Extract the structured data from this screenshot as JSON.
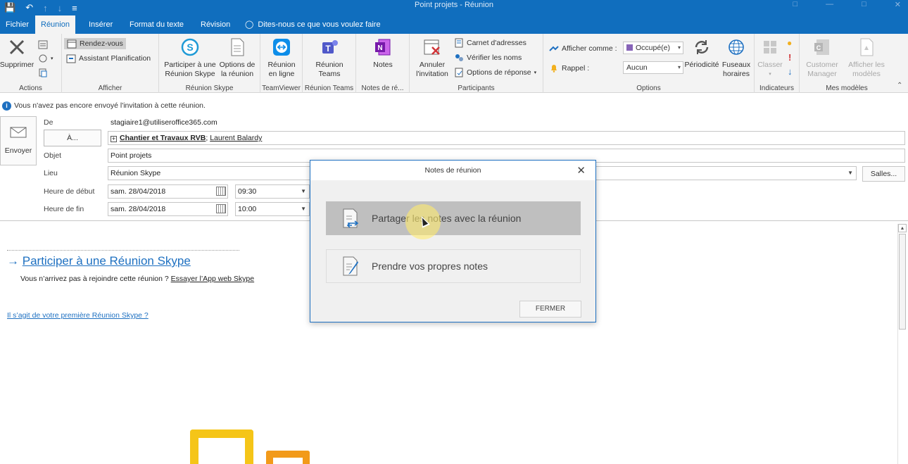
{
  "window": {
    "title": "Point projets  -  Réunion"
  },
  "ribbon_tabs": [
    {
      "label": "Fichier"
    },
    {
      "label": "Réunion"
    },
    {
      "label": "Insérer"
    },
    {
      "label": "Format du texte"
    },
    {
      "label": "Révision"
    }
  ],
  "tell_me": "Dites-nous ce que vous voulez faire",
  "ribbon": {
    "actions": {
      "label": "Actions",
      "supprimer": "Supprimer"
    },
    "afficher": {
      "label": "Afficher",
      "rendez_vous": "Rendez-vous",
      "assistant": "Assistant Planification"
    },
    "skype": {
      "label": "Réunion Skype",
      "participer_1": "Participer à une",
      "participer_2": "Réunion Skype",
      "options_1": "Options de",
      "options_2": "la réunion"
    },
    "teamviewer": {
      "label": "TeamViewer",
      "btn_1": "Réunion",
      "btn_2": "en ligne"
    },
    "teams": {
      "label": "Réunion Teams",
      "btn_1": "Réunion",
      "btn_2": "Teams"
    },
    "notes": {
      "label": "Notes de ré...",
      "btn": "Notes"
    },
    "participants": {
      "label": "Participants",
      "annuler_1": "Annuler",
      "annuler_2": "l'invitation",
      "carnet": "Carnet d'adresses",
      "verifier": "Vérifier les noms",
      "options_reponse": "Options de réponse"
    },
    "options": {
      "label": "Options",
      "afficher_comme": "Afficher comme :",
      "afficher_comme_value": "Occupé(e)",
      "rappel": "Rappel :",
      "rappel_value": "Aucun",
      "periodicite": "Périodicité",
      "fuseaux_1": "Fuseaux",
      "fuseaux_2": "horaires"
    },
    "indicateurs": {
      "label": "Indicateurs",
      "classer": "Classer"
    },
    "modeles": {
      "label": "Mes modèles",
      "customer_1": "Customer",
      "customer_2": "Manager",
      "afficher_1": "Afficher les",
      "afficher_2": "modèles"
    }
  },
  "info_message": "Vous n'avez pas encore envoyé l'invitation à cette réunion.",
  "form": {
    "send": "Envoyer",
    "de_label": "De",
    "de_value": "stagiaire1@utiliseroffice365.com",
    "a_button": "À...",
    "recipients": [
      "Chantier et Travaux RVB",
      "Laurent Balardy"
    ],
    "objet_label": "Objet",
    "objet_value": "Point projets",
    "lieu_label": "Lieu",
    "lieu_value": "Réunion Skype",
    "salles": "Salles...",
    "debut_label": "Heure de début",
    "debut_date": "sam. 28/04/2018",
    "debut_time": "09:30",
    "fin_label": "Heure de fin",
    "fin_date": "sam. 28/04/2018",
    "fin_time": "10:00"
  },
  "body": {
    "join_link": "Participer à une Réunion Skype",
    "sub_text": "Vous n’arrivez pas à rejoindre cette réunion ?",
    "sub_link": "Essayer l’App web Skype",
    "first_meeting": "Il s’agit de votre première Réunion Skype ?"
  },
  "dialog": {
    "title": "Notes de réunion",
    "option_share": "Partager les notes avec la réunion",
    "option_own": "Prendre vos propres notes",
    "close_button": "FERMER"
  },
  "colors": {
    "accent": "#106ebe",
    "link": "#1e70c1"
  }
}
